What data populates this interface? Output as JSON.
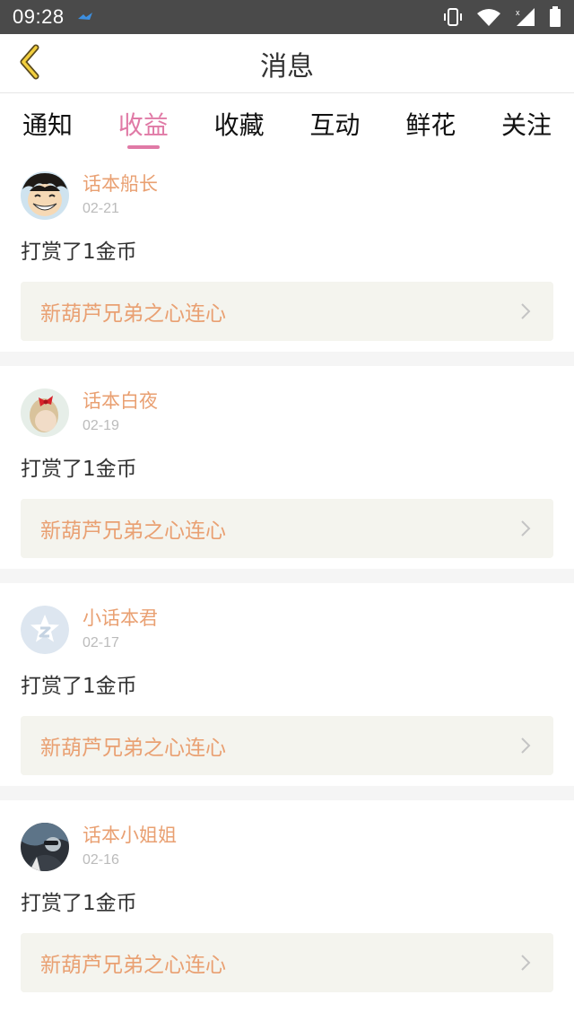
{
  "status_bar": {
    "time": "09:28",
    "icons": [
      "app-notification-icon",
      "vibrate-icon",
      "wifi-icon",
      "signal-icon",
      "battery-icon"
    ]
  },
  "header": {
    "title": "消息",
    "back_icon": "chevron-left-icon"
  },
  "tabs": [
    {
      "label": "通知",
      "active": false
    },
    {
      "label": "收益",
      "active": true
    },
    {
      "label": "收藏",
      "active": false
    },
    {
      "label": "互动",
      "active": false
    },
    {
      "label": "鲜花",
      "active": false
    },
    {
      "label": "关注",
      "active": false
    }
  ],
  "feed": [
    {
      "username": "话本船长",
      "date": "02-21",
      "message": "打赏了1金币",
      "book_title": "新葫芦兄弟之心连心",
      "avatar": "cartoon-avatar"
    },
    {
      "username": "话本白夜",
      "date": "02-19",
      "message": "打赏了1金币",
      "book_title": "新葫芦兄弟之心连心",
      "avatar": "girl-bow-avatar"
    },
    {
      "username": "小话本君",
      "date": "02-17",
      "message": "打赏了1金币",
      "book_title": "新葫芦兄弟之心连心",
      "avatar": "default-star-avatar"
    },
    {
      "username": "话本小姐姐",
      "date": "02-16",
      "message": "打赏了1金币",
      "book_title": "新葫芦兄弟之心连心",
      "avatar": "photo-avatar"
    }
  ],
  "colors": {
    "accent_pink": "#e07aa6",
    "accent_orange": "#e9a072",
    "status_bar": "#4a4a4a",
    "card_link_bg": "#f4f4ee"
  }
}
